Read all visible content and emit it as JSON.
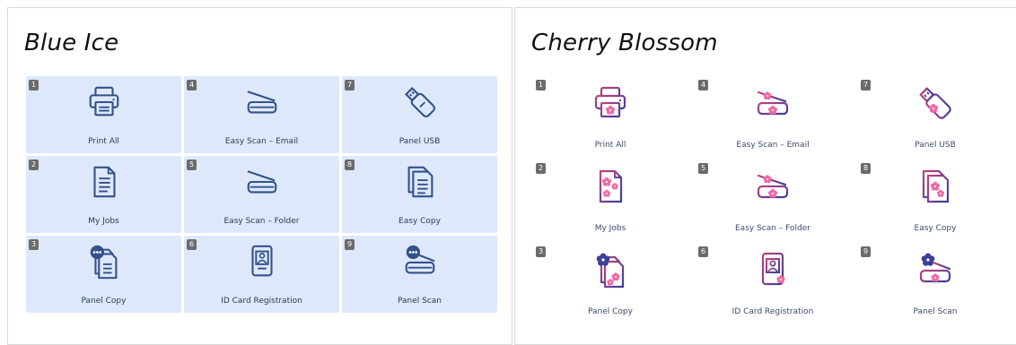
{
  "themes": [
    {
      "title": "Blue Ice",
      "tiles": [
        {
          "number": "1",
          "label": "Print All",
          "icon": "printer-icon"
        },
        {
          "number": "4",
          "label": "Easy Scan – Email",
          "icon": "scanner-icon"
        },
        {
          "number": "7",
          "label": "Panel USB",
          "icon": "usb-icon"
        },
        {
          "number": "2",
          "label": "My Jobs",
          "icon": "document-icon"
        },
        {
          "number": "5",
          "label": "Easy Scan – Folder",
          "icon": "scanner-icon"
        },
        {
          "number": "8",
          "label": "Easy Copy",
          "icon": "copy-icon"
        },
        {
          "number": "3",
          "label": "Panel Copy",
          "icon": "panel-copy-icon"
        },
        {
          "number": "6",
          "label": "ID Card Registration",
          "icon": "id-card-icon"
        },
        {
          "number": "9",
          "label": "Panel Scan",
          "icon": "panel-scan-icon"
        }
      ]
    },
    {
      "title": "Cherry Blossom",
      "tiles": [
        {
          "number": "1",
          "label": "Print All",
          "icon": "printer-icon"
        },
        {
          "number": "4",
          "label": "Easy Scan – Email",
          "icon": "scanner-icon"
        },
        {
          "number": "7",
          "label": "Panel USB",
          "icon": "usb-icon"
        },
        {
          "number": "2",
          "label": "My Jobs",
          "icon": "document-icon"
        },
        {
          "number": "5",
          "label": "Easy Scan – Folder",
          "icon": "scanner-icon"
        },
        {
          "number": "8",
          "label": "Easy Copy",
          "icon": "copy-icon"
        },
        {
          "number": "3",
          "label": "Panel Copy",
          "icon": "panel-copy-icon"
        },
        {
          "number": "6",
          "label": "ID Card Registration",
          "icon": "id-card-icon"
        },
        {
          "number": "9",
          "label": "Panel Scan",
          "icon": "panel-scan-icon"
        }
      ]
    }
  ],
  "colors": {
    "blue_tile": "#dde8fb",
    "blue_stroke": "#34518a",
    "cherry_stroke_start": "#c0427f",
    "cherry_stroke_end": "#3a3f99",
    "blossom": "#f06aa7"
  }
}
